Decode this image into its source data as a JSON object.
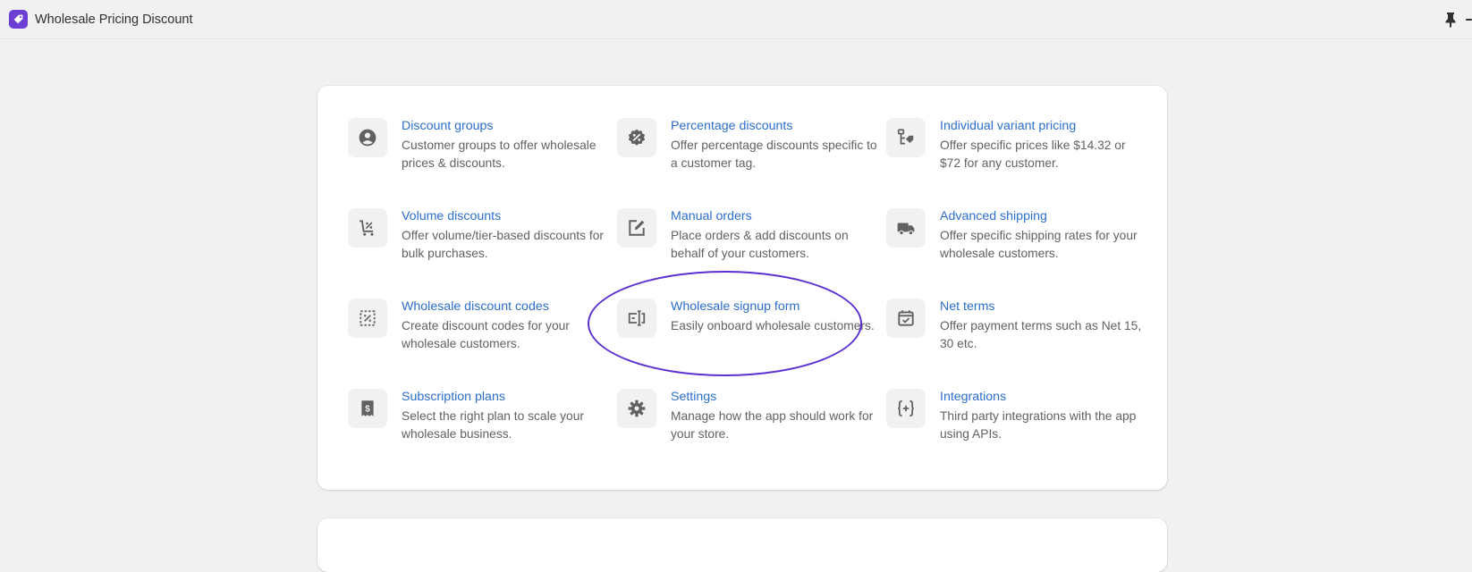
{
  "header": {
    "app_title": "Wholesale Pricing Discount"
  },
  "colors": {
    "brand": "#6b3fd4",
    "link": "#2c6ecb",
    "annotation": "#5b2fd0"
  },
  "tiles": [
    {
      "icon": "customer-icon",
      "title": "Discount groups",
      "desc": "Customer groups to offer wholesale prices & discounts."
    },
    {
      "icon": "percent-badge-icon",
      "title": "Percentage discounts",
      "desc": "Offer percentage discounts specific to a customer tag."
    },
    {
      "icon": "variant-price-tag-icon",
      "title": "Individual variant pricing",
      "desc": "Offer specific prices like $14.32 or $72 for any customer."
    },
    {
      "icon": "cart-discount-icon",
      "title": "Volume discounts",
      "desc": "Offer volume/tier-based discounts for bulk purchases."
    },
    {
      "icon": "edit-order-icon",
      "title": "Manual orders",
      "desc": "Place orders & add discounts on behalf of your customers."
    },
    {
      "icon": "truck-icon",
      "title": "Advanced shipping",
      "desc": "Offer specific shipping rates for your wholesale customers."
    },
    {
      "icon": "discount-code-icon",
      "title": "Wholesale discount codes",
      "desc": "Create discount codes for your wholesale customers."
    },
    {
      "icon": "form-field-icon",
      "title": "Wholesale signup form",
      "desc": "Easily onboard wholesale customers."
    },
    {
      "icon": "calendar-check-icon",
      "title": "Net terms",
      "desc": "Offer payment terms such as Net 15, 30 etc."
    },
    {
      "icon": "receipt-dollar-icon",
      "title": "Subscription plans",
      "desc": "Select the right plan to scale your wholesale business."
    },
    {
      "icon": "gear-icon",
      "title": "Settings",
      "desc": "Manage how the app should work for your store."
    },
    {
      "icon": "code-braces-icon",
      "title": "Integrations",
      "desc": "Third party integrations with the app using APIs."
    }
  ]
}
